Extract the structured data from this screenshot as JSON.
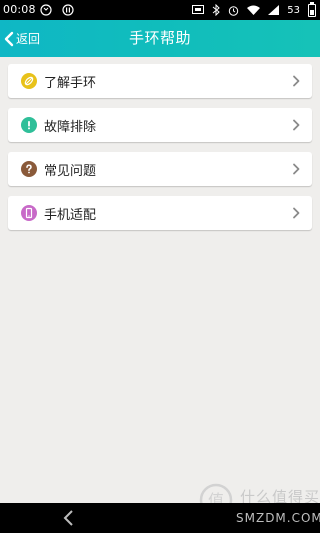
{
  "status_bar": {
    "time": "00:08",
    "battery": "53"
  },
  "header": {
    "back_label": "返回",
    "title": "手环帮助"
  },
  "menu": [
    {
      "label": "了解手环",
      "icon": "leaf-icon",
      "color": "#e8c21a"
    },
    {
      "label": "故障排除",
      "icon": "exclamation-icon",
      "color": "#2fbf99"
    },
    {
      "label": "常见问题",
      "icon": "question-icon",
      "color": "#8a5a3a"
    },
    {
      "label": "手机适配",
      "icon": "phone-icon",
      "color": "#c86ac8"
    }
  ],
  "watermark": {
    "text": "什么值得买",
    "domain": "SMZDM.COM"
  }
}
